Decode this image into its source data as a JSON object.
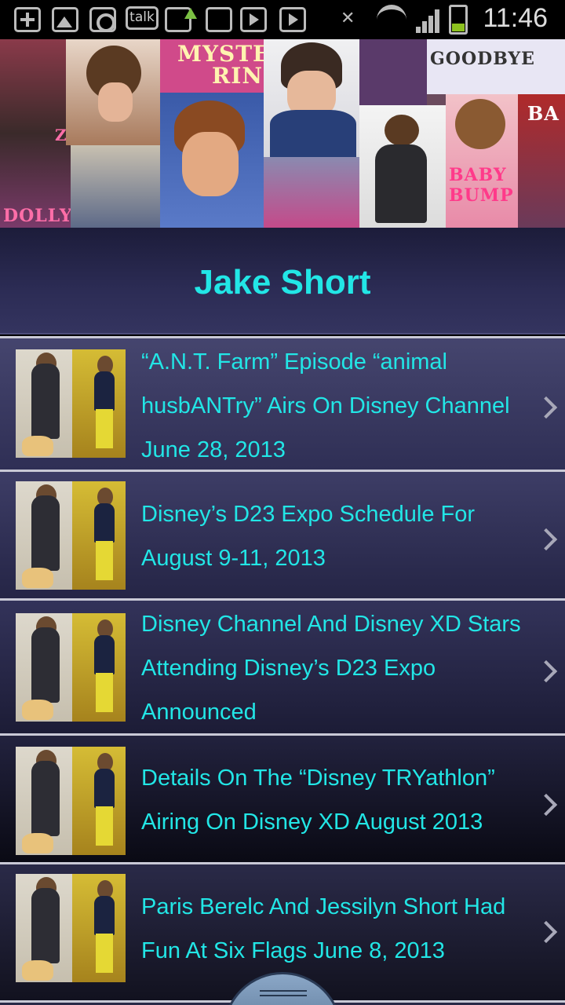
{
  "status_bar": {
    "time": "11:46",
    "talk_label": "talk",
    "battery_level": 0.3,
    "icons": [
      "plus-icon",
      "image-icon",
      "upload-icon",
      "talk-icon",
      "app-update-icon",
      "film-icon",
      "play-icon",
      "play-store-icon",
      "mute-icon",
      "wifi-icon",
      "signal-icon",
      "battery-icon"
    ]
  },
  "banner": {
    "mag_texts": [
      "MYSTE",
      "RING",
      "GOODBYE",
      "ZAC",
      "DOLLY",
      "BABY BUMP",
      "BA"
    ]
  },
  "header": {
    "title": "Jake Short"
  },
  "articles": [
    {
      "title": "“A.N.T. Farm” Episode “animal husbANTry” Airs On Disney Channel June 28, 2013"
    },
    {
      "title": "Disney’s D23 Expo Schedule For August 9-11, 2013"
    },
    {
      "title": "Disney Channel And Disney XD Stars Attending Disney’s D23 Expo Announced"
    },
    {
      "title": "Details On The “Disney TRYathlon” Airing On Disney XD August 2013"
    },
    {
      "title": "Paris Berelc And Jessilyn Short Had Fun At Six Flags June 8, 2013"
    }
  ],
  "colors": {
    "accent_text": "#22e6e6",
    "chevron": "#a8a8b8",
    "divider": "#c9c9d6"
  }
}
